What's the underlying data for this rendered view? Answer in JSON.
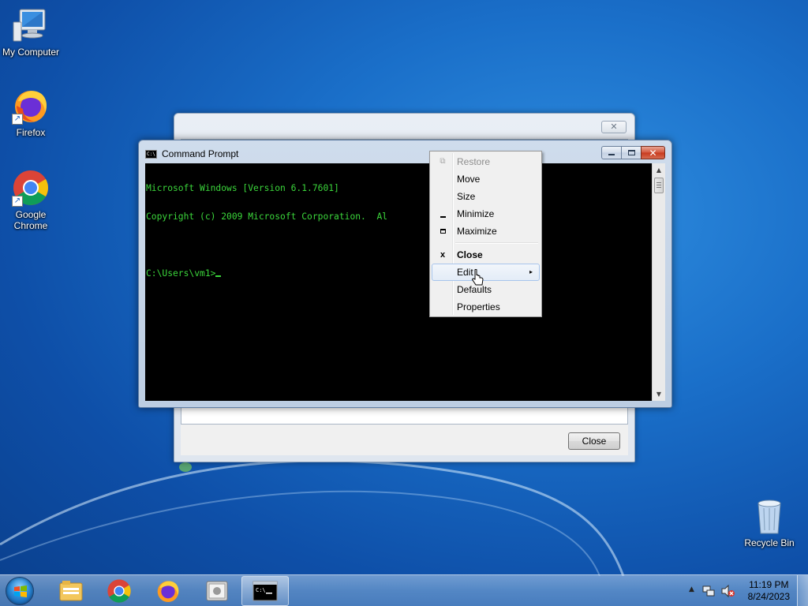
{
  "desktop": {
    "icons": [
      {
        "label": "My Computer",
        "icon": "computer-icon"
      },
      {
        "label": "Firefox",
        "icon": "firefox-icon"
      },
      {
        "label": "Google Chrome",
        "icon": "chrome-icon"
      },
      {
        "label": "Recycle Bin",
        "icon": "recycle-bin-icon"
      }
    ]
  },
  "back_dialog": {
    "close_glyph": "✕",
    "close_button_label": "Close"
  },
  "cmd_window": {
    "title": "Command Prompt",
    "icon_text": "C:\\",
    "console_lines": [
      "Microsoft Windows [Version 6.1.7601]",
      "Copyright (c) 2009 Microsoft Corporation.  Al"
    ],
    "prompt": "C:\\Users\\vm1>",
    "text_color": "#3bd63b",
    "background_color": "#000000"
  },
  "context_menu": {
    "items": [
      {
        "label": "Restore",
        "glyph": "restore-icon",
        "disabled": true
      },
      {
        "label": "Move"
      },
      {
        "label": "Size"
      },
      {
        "label": "Minimize",
        "glyph": "minimize-icon"
      },
      {
        "label": "Maximize",
        "glyph": "maximize-icon"
      },
      {
        "label": "Close",
        "glyph": "close-icon",
        "bold": true
      },
      {
        "label": "Edit",
        "submenu": true,
        "hovered": true
      },
      {
        "label": "Defaults"
      },
      {
        "label": "Properties"
      }
    ],
    "close_glyph": "x",
    "submenu_arrow": "▸"
  },
  "taskbar": {
    "pinned": [
      "start-orb",
      "explorer-icon",
      "chrome-icon",
      "firefox-icon",
      "disk-utility-icon",
      "cmd-icon"
    ],
    "active": "cmd-icon",
    "tray_chevron": "▲",
    "time": "11:19 PM",
    "date": "8/24/2023"
  }
}
